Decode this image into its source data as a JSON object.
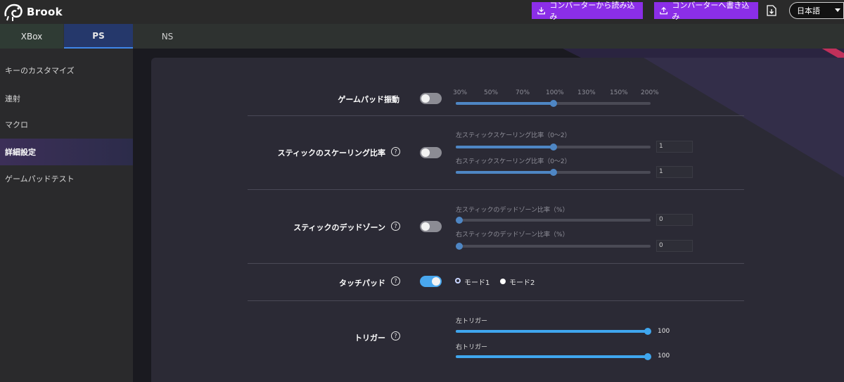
{
  "header": {
    "brand": "Brook",
    "read_button": "コンバーターから読み込み",
    "write_button": "コンバーターへ書き込み",
    "language": "日本語"
  },
  "tabs": [
    {
      "label": "XBox"
    },
    {
      "label": "PS"
    },
    {
      "label": "NS"
    }
  ],
  "sidebar": {
    "items": [
      {
        "label": "キーのカスタマイズ"
      },
      {
        "label": "連射"
      },
      {
        "label": "マクロ"
      },
      {
        "label": "詳細設定"
      },
      {
        "label": "ゲームパッドテスト"
      }
    ]
  },
  "settings": {
    "vibration": {
      "label": "ゲームパッド振動",
      "enabled": false,
      "ticks": [
        "30%",
        "50%",
        "70%",
        "100%",
        "130%",
        "150%",
        "200%"
      ],
      "selected": "100%"
    },
    "stick_scaling": {
      "label": "スティックのスケーリング比率",
      "enabled": false,
      "left_label": "左スティックスケーリング比率（0〜2）",
      "left_value": "1",
      "right_label": "右スティックスケーリング比率（0〜2）",
      "right_value": "1"
    },
    "deadzone": {
      "label": "スティックのデッドゾーン",
      "enabled": false,
      "left_label": "左スティックのデッドゾーン比率（%）",
      "left_value": "0",
      "right_label": "右スティックのデッドゾーン比率（%）",
      "right_value": "0"
    },
    "touchpad": {
      "label": "タッチパッド",
      "enabled": true,
      "mode1": "モード1",
      "mode2": "モード2",
      "selected": "モード1"
    },
    "trigger": {
      "label": "トリガー",
      "left_label": "左トリガー",
      "left_value": "100",
      "right_label": "右トリガー",
      "right_value": "100"
    }
  },
  "colors": {
    "accent_purple": "#8b2ee8",
    "accent_blue": "#3fa6ee",
    "tab_active": "#25386b"
  }
}
